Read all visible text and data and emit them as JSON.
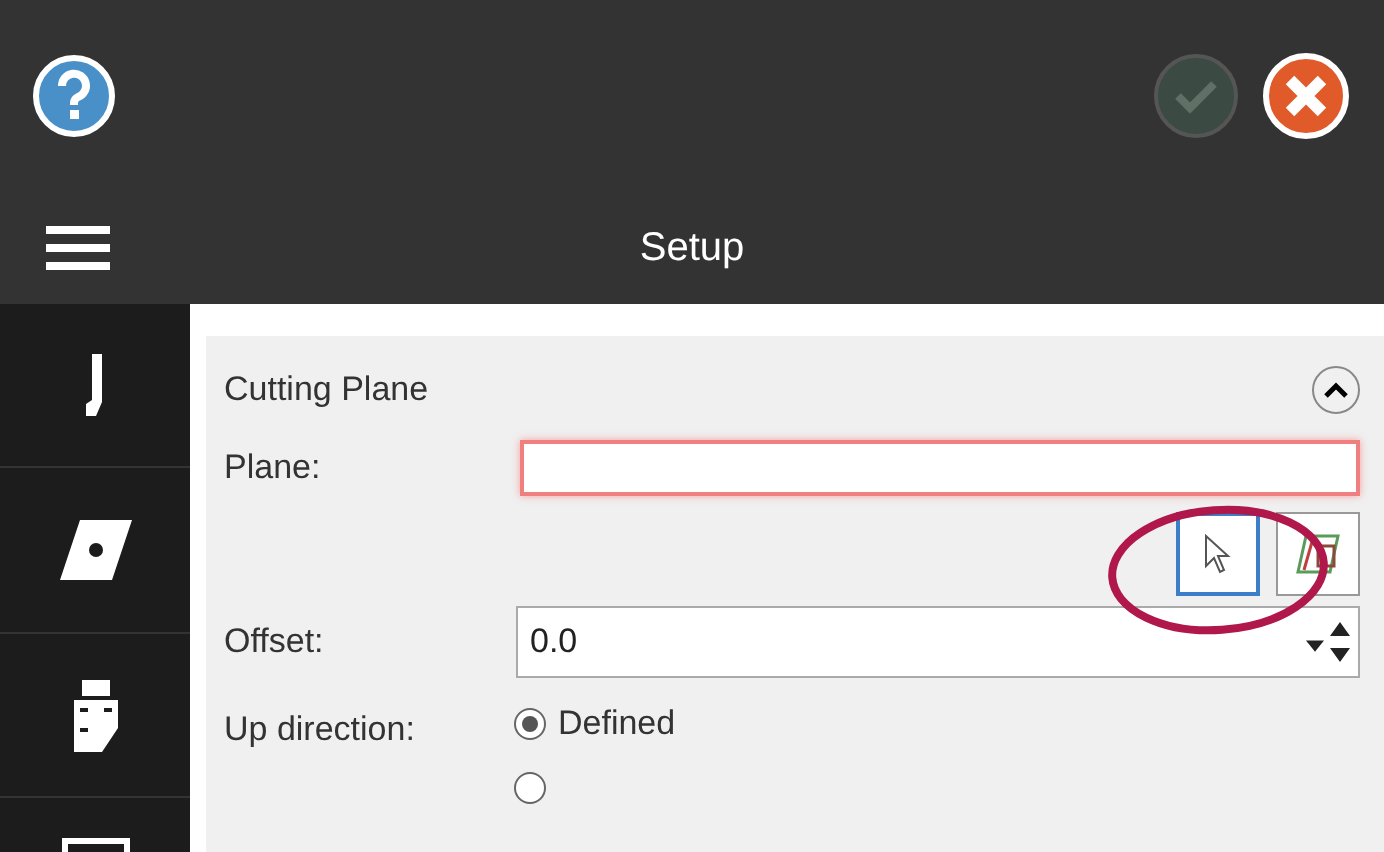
{
  "header": {
    "title": "Setup",
    "accept_button": {
      "disabled": true
    }
  },
  "section": {
    "title": "Cutting Plane",
    "expanded": true,
    "plane": {
      "label": "Plane:",
      "invalid": true
    },
    "pick_buttons": [
      {
        "kind": "pointer",
        "selected": true
      },
      {
        "kind": "plane",
        "selected": false
      }
    ],
    "offset": {
      "label": "Offset:",
      "value": "0.0"
    },
    "up_direction": {
      "label": "Up direction:",
      "options": [
        {
          "label": "Defined",
          "selected": true
        },
        {
          "selected": false
        }
      ]
    }
  }
}
